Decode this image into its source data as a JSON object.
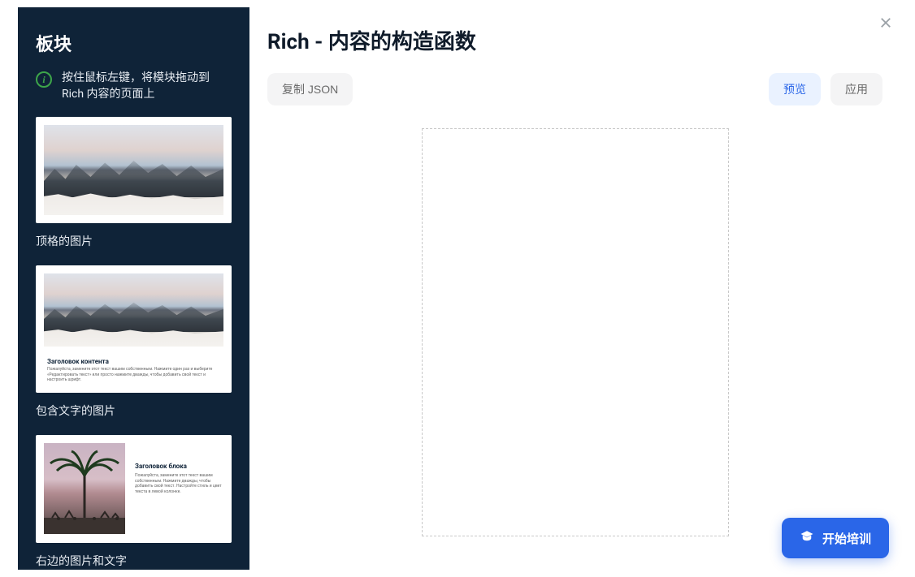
{
  "sidebar": {
    "title": "板块",
    "info_text": "按住鼠标左键，将模块拖动到 Rich 内容的页面上",
    "templates": [
      {
        "caption": "顶格的图片"
      },
      {
        "caption": "包含文字的图片",
        "thumb_title": "Заголовок контента",
        "thumb_body": "Пожалуйста, замените этот текст вашим собственным. Нажмите один раз и выберите «Редактировать текст» или просто нажмите дважды, чтобы добавить свой текст и настроить шрифт."
      },
      {
        "caption": "右边的图片和文字",
        "thumb_title": "Заголовок блока",
        "thumb_body": "Пожалуйста, замените этот текст вашим собственным. Нажмите дважды, чтобы добавить свой текст. Настройте стиль и цвет текста в левой колонке."
      }
    ]
  },
  "main": {
    "title": "Rich - 内容的构造函数",
    "toolbar": {
      "copy_json_label": "复制 JSON",
      "preview_label": "预览",
      "apply_label": "应用"
    }
  },
  "fab": {
    "label": "开始培训"
  },
  "colors": {
    "sidebar_bg": "#0f2338",
    "accent": "#2a66e8",
    "info_icon": "#3da64a"
  }
}
